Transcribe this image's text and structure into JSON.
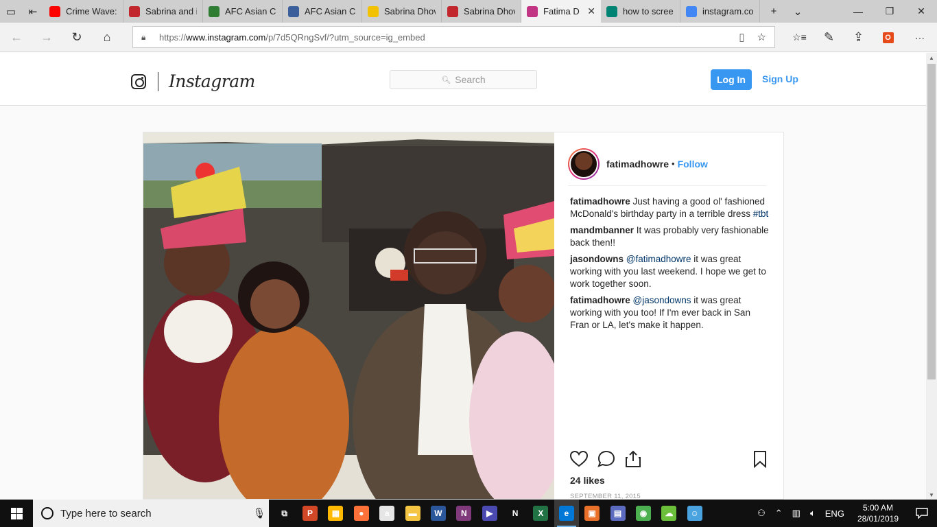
{
  "browser": {
    "tabs": [
      {
        "label": "Crime Wave:",
        "icon": "youtube-icon",
        "color": "#ff0000"
      },
      {
        "label": "Sabrina and i",
        "icon": "map-pin-icon",
        "color": "#c1272d"
      },
      {
        "label": "AFC Asian Cu",
        "icon": "afc-icon",
        "color": "#2e7d32"
      },
      {
        "label": "AFC Asian Cu",
        "icon": "afc-logo-icon",
        "color": "#3a5f9a"
      },
      {
        "label": "Sabrina Dhov",
        "icon": "star-icon",
        "color": "#f2c200"
      },
      {
        "label": "Sabrina Dhov",
        "icon": "map-pin-icon",
        "color": "#c1272d"
      },
      {
        "label": "Fatima D",
        "icon": "instagram-icon",
        "color": "#c13584",
        "active": true
      },
      {
        "label": "how to scree",
        "icon": "bing-icon",
        "color": "#008373"
      },
      {
        "label": "instagram.co",
        "icon": "google-icon",
        "color": "#4285f4"
      }
    ],
    "new_tab": "+",
    "tab_list": "⌄",
    "window": {
      "minimize": "—",
      "restore": "❐",
      "close": "✕"
    },
    "nav": {
      "back": "←",
      "forward": "→",
      "refresh": "↻",
      "home": "⌂"
    },
    "url": {
      "prefix": "https://",
      "host": "www.instagram.com",
      "path": "/p/7d5QRngSvf/?utm_source=ig_embed"
    },
    "toolbar": {
      "reading_view": "▯",
      "favorite": "☆",
      "favorites_hub": "☆≡",
      "notes": "✎",
      "share": "⇪",
      "office": "O",
      "more": "···"
    }
  },
  "instagram": {
    "wordmark": "Instagram",
    "search_placeholder": "Search",
    "login": "Log In",
    "signup": "Sign Up"
  },
  "post": {
    "username": "fatimadhowre",
    "separator": "•",
    "follow": "Follow",
    "comments": [
      {
        "user": "fatimadhowre",
        "pre": "Just having a good ol' fashioned McDonald's birthday party in a terrible dress ",
        "mention": "#tbt",
        "post": ""
      },
      {
        "user": "mandmbanner",
        "pre": "It was probably very fashionable back then!!",
        "mention": "",
        "post": ""
      },
      {
        "user": "jasondowns",
        "pre": "",
        "mention": "@fatimadhowre",
        "post": " it was great working with you last weekend. I hope we get to work together soon."
      },
      {
        "user": "fatimadhowre",
        "pre": "",
        "mention": "@jasondowns",
        "post": " it was great working with you too! If I'm ever back in San Fran or LA, let's make it happen."
      }
    ],
    "likes": "24 likes",
    "date": "SEPTEMBER 11, 2015"
  },
  "taskbar": {
    "search_placeholder": "Type here to search",
    "apps": [
      {
        "name": "task-view-icon",
        "glyph": "⧉",
        "color": "#101010"
      },
      {
        "name": "powerpoint-icon",
        "glyph": "P",
        "color": "#d24726"
      },
      {
        "name": "store-icon",
        "glyph": "▦",
        "color": "#ffb900"
      },
      {
        "name": "firefox-icon",
        "glyph": "●",
        "color": "#ff7139"
      },
      {
        "name": "amazon-icon",
        "glyph": "a",
        "color": "#e6e6e6"
      },
      {
        "name": "file-explorer-icon",
        "glyph": "▬",
        "color": "#f4c542"
      },
      {
        "name": "word-icon",
        "glyph": "W",
        "color": "#2b579a"
      },
      {
        "name": "onenote-icon",
        "glyph": "N",
        "color": "#80397b"
      },
      {
        "name": "media-player-icon",
        "glyph": "▶",
        "color": "#4a4ab0"
      },
      {
        "name": "netflix-icon",
        "glyph": "N",
        "color": "#101010"
      },
      {
        "name": "excel-icon",
        "glyph": "X",
        "color": "#217346"
      },
      {
        "name": "edge-icon",
        "glyph": "e",
        "color": "#0078d7",
        "active": true
      },
      {
        "name": "photos-icon",
        "glyph": "▣",
        "color": "#e8702a"
      },
      {
        "name": "clipboard-app-icon",
        "glyph": "▤",
        "color": "#5c6bc0"
      },
      {
        "name": "chrome-icon",
        "glyph": "◉",
        "color": "#4caf50"
      },
      {
        "name": "cloud-app-icon",
        "glyph": "☁",
        "color": "#6cbf3a"
      },
      {
        "name": "chat-app-icon",
        "glyph": "☺",
        "color": "#4aa3df"
      }
    ],
    "tray": {
      "chevron": "⌃",
      "language": "ENG",
      "time": "5:00 AM",
      "date": "28/01/2019"
    }
  }
}
